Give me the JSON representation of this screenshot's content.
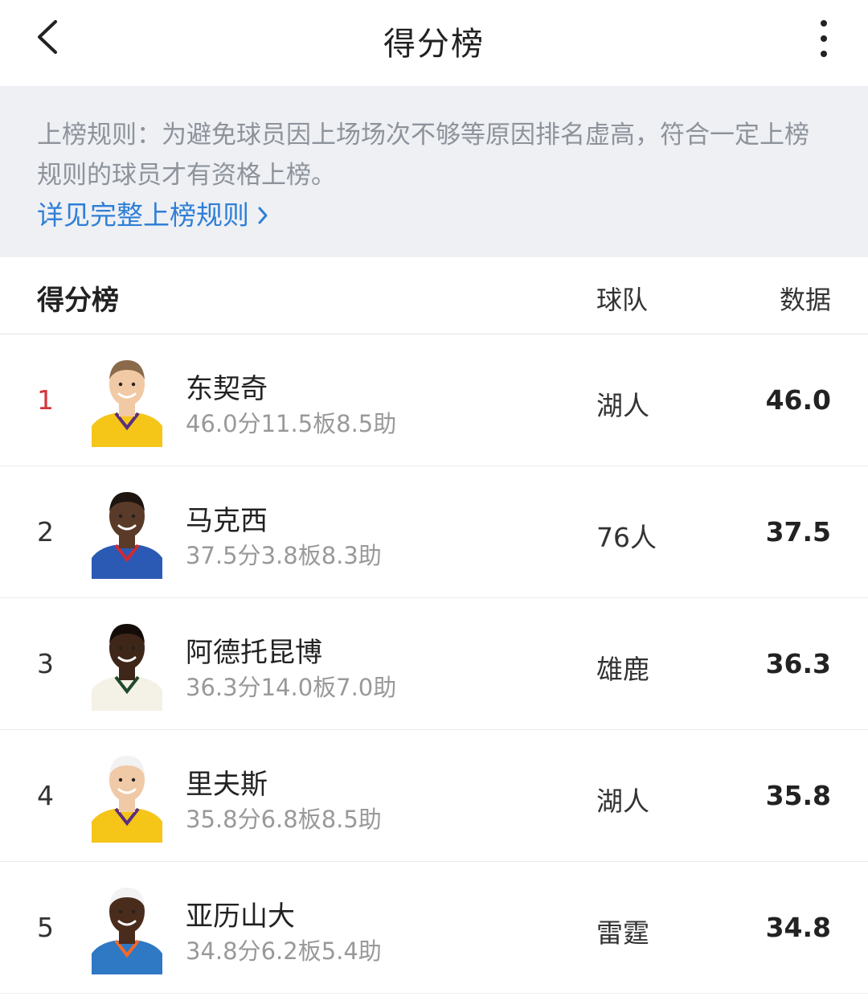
{
  "header": {
    "title": "得分榜"
  },
  "notice": {
    "text": "上榜规则：为避免球员因上场场次不够等原因排名虚高，符合一定上榜规则的球员才有资格上榜。",
    "link_label": "详见完整上榜规则"
  },
  "table": {
    "title": "得分榜",
    "team_header": "球队",
    "stat_header": "数据"
  },
  "players": [
    {
      "rank": "1",
      "name": "东契奇",
      "line": "46.0分11.5板8.5助",
      "team": "湖人",
      "stat": "46.0",
      "jersey": "#f5c518",
      "trim": "#5a2d82",
      "skin": "#f2c9a5",
      "hair": "#8a6a4a"
    },
    {
      "rank": "2",
      "name": "马克西",
      "line": "37.5分3.8板8.3助",
      "team": "76人",
      "stat": "37.5",
      "jersey": "#2b5ab5",
      "trim": "#d02a32",
      "skin": "#5a3a28",
      "hair": "#1e1410"
    },
    {
      "rank": "3",
      "name": "阿德托昆博",
      "line": "36.3分14.0板7.0助",
      "team": "雄鹿",
      "stat": "36.3",
      "jersey": "#f4f1e6",
      "trim": "#1f4a2b",
      "skin": "#3e2619",
      "hair": "#140c08"
    },
    {
      "rank": "4",
      "name": "里夫斯",
      "line": "35.8分6.8板8.5助",
      "team": "湖人",
      "stat": "35.8",
      "jersey": "#f5c518",
      "trim": "#5a2d82",
      "skin": "#f0c9a6",
      "hair": "#f2f2f2"
    },
    {
      "rank": "5",
      "name": "亚历山大",
      "line": "34.8分6.2板5.4助",
      "team": "雷霆",
      "stat": "34.8",
      "jersey": "#2f78c4",
      "trim": "#f2692a",
      "skin": "#4a2c1c",
      "hair": "#f2f2f2"
    }
  ],
  "colors": {
    "accent_link": "#2f7fd6",
    "rank_top": "#d6343c",
    "notice_bg": "#eef0f4"
  },
  "icons": {
    "back": "chevron-left-icon",
    "more": "more-vertical-icon",
    "link_arrow": "chevron-right-icon"
  }
}
